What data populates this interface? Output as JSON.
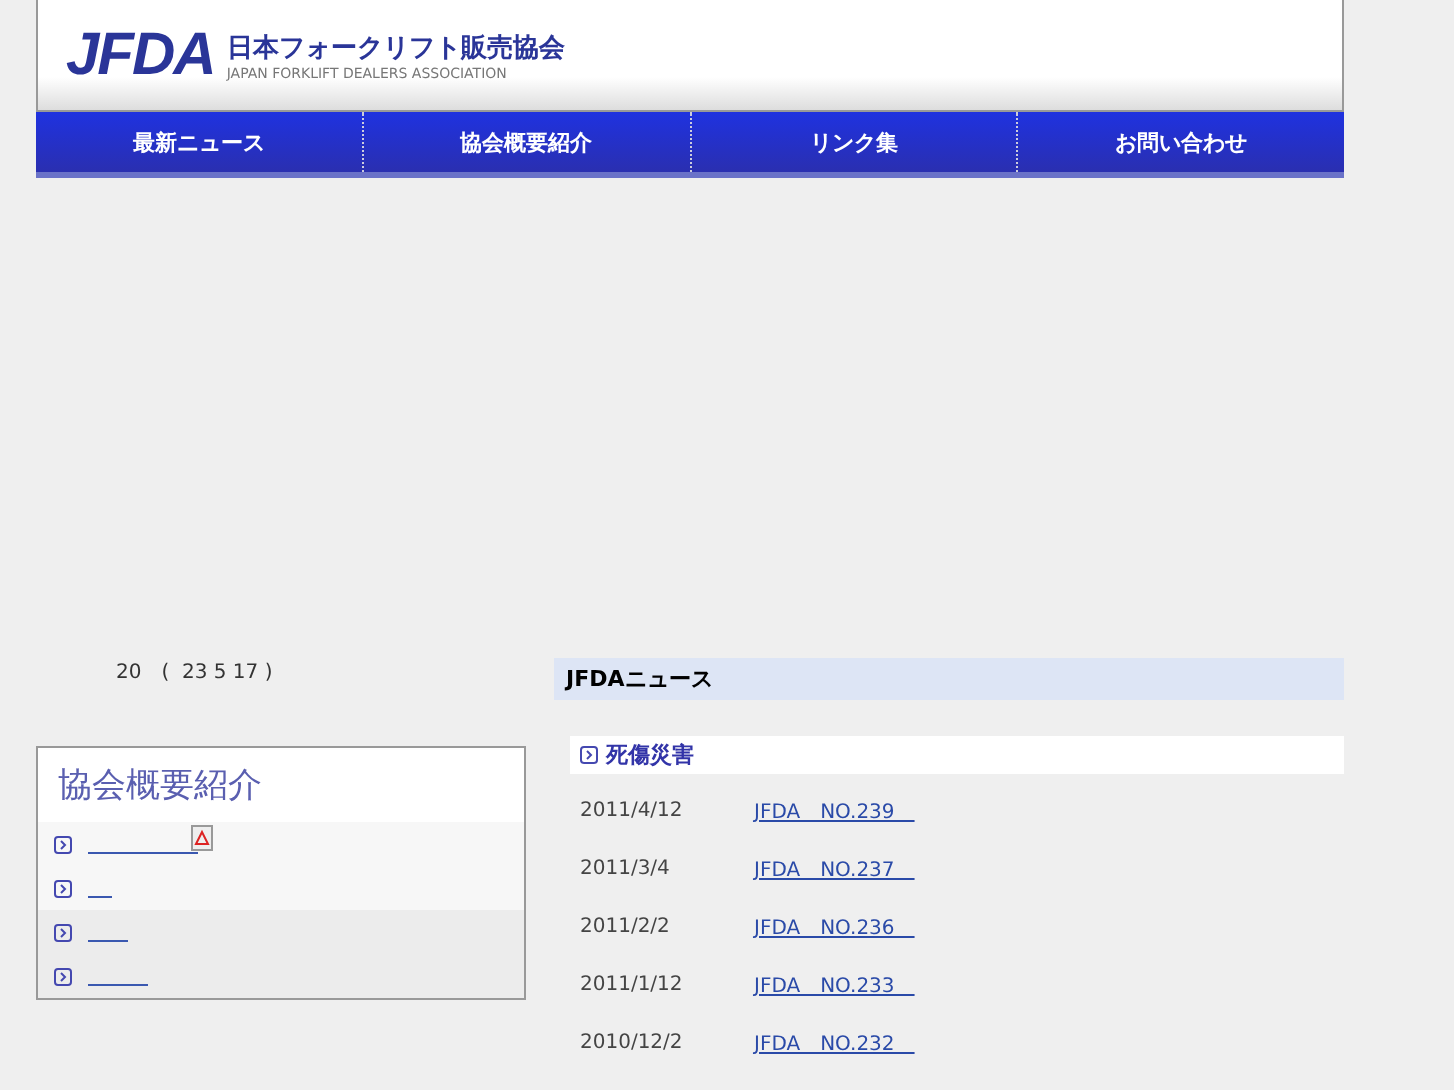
{
  "header": {
    "logo": "JFDA",
    "org_name": "日本フォークリフト販売協会",
    "org_name_en": "JAPAN FORKLIFT DEALERS ASSOCIATION"
  },
  "nav": [
    "最新ニュース",
    "協会概要紹介",
    "リンク集",
    "お問い合わせ"
  ],
  "date_note": "20　(  23 5 17 )",
  "sidebar": {
    "title": "協会概要紹介",
    "items": [
      {
        "kind": "pdf"
      },
      {
        "kind": "plain"
      },
      {
        "kind": "plain"
      },
      {
        "kind": "plain"
      }
    ]
  },
  "news": {
    "title": "JFDAニュース",
    "category": "死傷災害",
    "rows": [
      {
        "date": "2011/4/12",
        "link": "JFDA　NO.239　"
      },
      {
        "date": "2011/3/4",
        "link": "JFDA　NO.237　"
      },
      {
        "date": "2011/2/2",
        "link": "JFDA　NO.236　"
      },
      {
        "date": "2011/1/12",
        "link": "JFDA　NO.233　"
      },
      {
        "date": "2010/12/2",
        "link": "JFDA　NO.232　"
      }
    ]
  }
}
